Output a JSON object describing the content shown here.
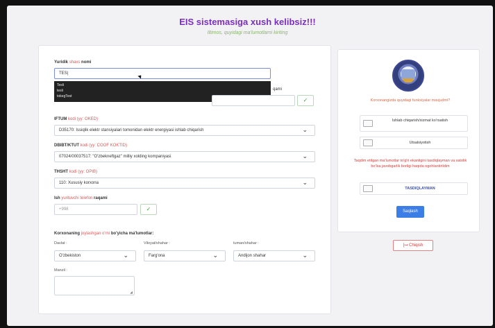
{
  "header": {
    "title": "EIS sistemasiga xush kelibsiz!!!",
    "subtitle": "Iltimos, quyidagi ma'lumotlarni kiriting"
  },
  "form": {
    "company_label_pre": "Yuridik",
    "company_label_hl": "shaxs",
    "company_label_post": "nomi",
    "company_value": "TES|",
    "suggestions": [
      "Tesli",
      "tesli",
      "tokegTest"
    ],
    "hidden_label_tail": "qami",
    "ifutm_label_pre": "IFTUM",
    "ifutm_label_hl": "kodi (yy: OKED)",
    "ifutm_value": "D35170: Issiqlik elektr stansiyalari tomonidan elektr energiyasi ishlab chiqarish",
    "dbibt_label_pre": "DBIBT/KTUT",
    "dbibt_label_hl": "kodi (yy: COOF KOKTID)",
    "dbibt_value": "07024/00037517: \"O'zbekneftgaz\" milliy xolding kompaniyasi",
    "tshxt_label_pre": "THSHT",
    "tshxt_label_hl": "kodi (yy: OPIB)",
    "tshxt_value": "110: Xususiy korxona",
    "phone_label_pre": "Ish",
    "phone_label_hl": "yurituvchi telefon",
    "phone_label_post": "raqami",
    "phone_value": "+998",
    "check_icon": "✓",
    "section_pre": "Korxonaning",
    "section_hl": "joylashgan o'rni",
    "section_post": "bo'yicha ma'lumotlar:",
    "country_label": "Davlat :",
    "country_value": "O'zbekiston",
    "region_label": "Viloyat/shahar :",
    "region_value": "Farg'ona",
    "district_label": "tuman/shahar :",
    "district_value": "Andijon shahar",
    "address_label": "Manzil :"
  },
  "right": {
    "question": "Korxonangizda quyidagi funksiyalar mavjudmi?",
    "options": [
      "Ishlab chiqarish/xizmat ko'rsatish",
      "Utsalsiyotish"
    ],
    "warning": "Taqdim etilgan ma'lumotlar to'g'ri ekanligini tasdiqlayman va xatolik bo'lsa javobgarlik borligi haqida ogohlantirildim",
    "confirm_label": "TASDIQLAYMAN",
    "submit_label": "Saqlash",
    "logout_label": "[↦ Chiqish"
  },
  "colors": {
    "title": "#7a2fbf",
    "accent_green": "#8ab56b",
    "primary": "#3c7ee5",
    "danger": "#d33a3a"
  }
}
